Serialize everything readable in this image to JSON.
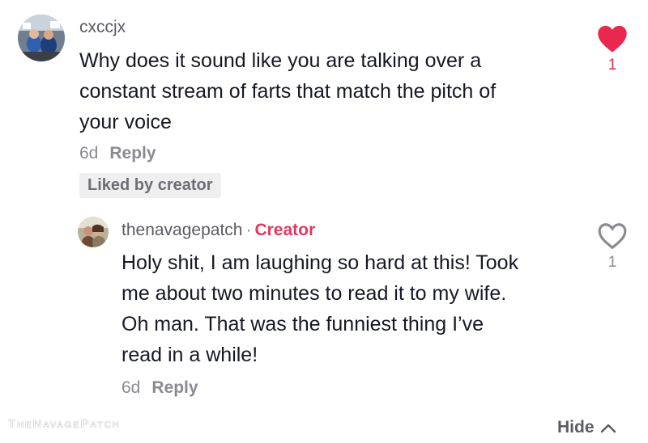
{
  "comment": {
    "username": "cxccjx",
    "text_lines": [
      "Why does it sound like you are talking over a",
      "constant stream of farts that match the pitch of",
      "your voice"
    ],
    "age": "6d",
    "reply_label": "Reply",
    "liked_by_creator": "Liked by creator",
    "like_count": "1",
    "liked": true
  },
  "reply": {
    "username": "thenavagepatch",
    "separator": "·",
    "creator_label": "Creator",
    "text_lines": [
      "Holy shit, I am laughing so hard at this! Took",
      "me about two minutes to read it to my wife.",
      "Oh man. That was the funniest thing I’ve",
      "read in a while!"
    ],
    "age": "6d",
    "reply_label": "Reply",
    "like_count": "1",
    "liked": false
  },
  "hide_label": "Hide",
  "watermark": "TheNavagePatch",
  "colors": {
    "heart_filled": "#ea284f",
    "creator": "#e2395d",
    "count_liked": "#ea284f"
  }
}
